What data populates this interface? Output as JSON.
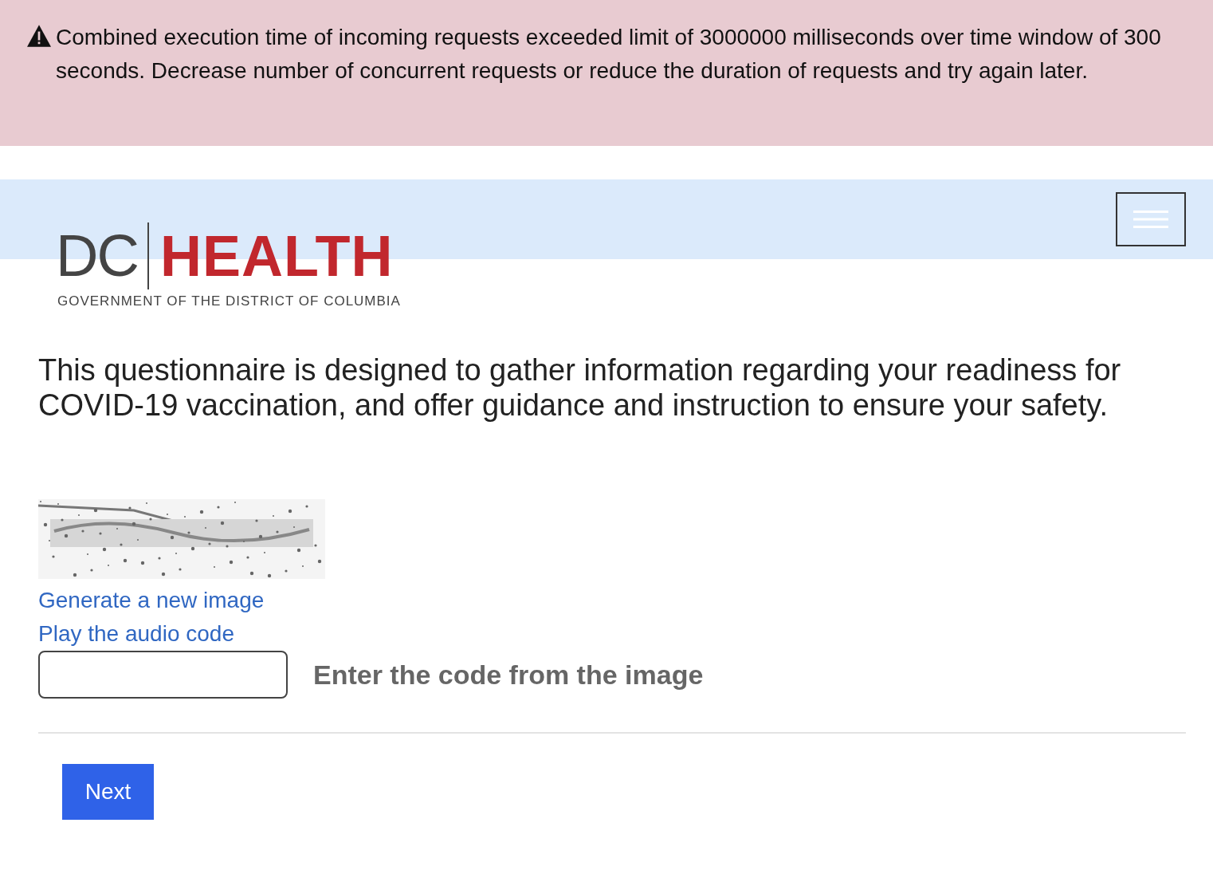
{
  "alert": {
    "text": "Combined execution time of incoming requests exceeded limit of 3000000 milliseconds over time window of 300 seconds. Decrease number of concurrent requests or reduce the duration of requests and try again later."
  },
  "logo": {
    "prefix": "DC",
    "name": "HEALTH",
    "subtitle": "GOVERNMENT OF THE DISTRICT OF COLUMBIA"
  },
  "intro": "This questionnaire is designed to gather information regarding your readiness for COVID-19 vaccination, and offer guidance and instruction to ensure your safety.",
  "captcha": {
    "links": [
      "Generate a new image",
      "Play the audio code"
    ],
    "field_label": "Enter the code from the image"
  },
  "buttons": [
    "Next"
  ]
}
